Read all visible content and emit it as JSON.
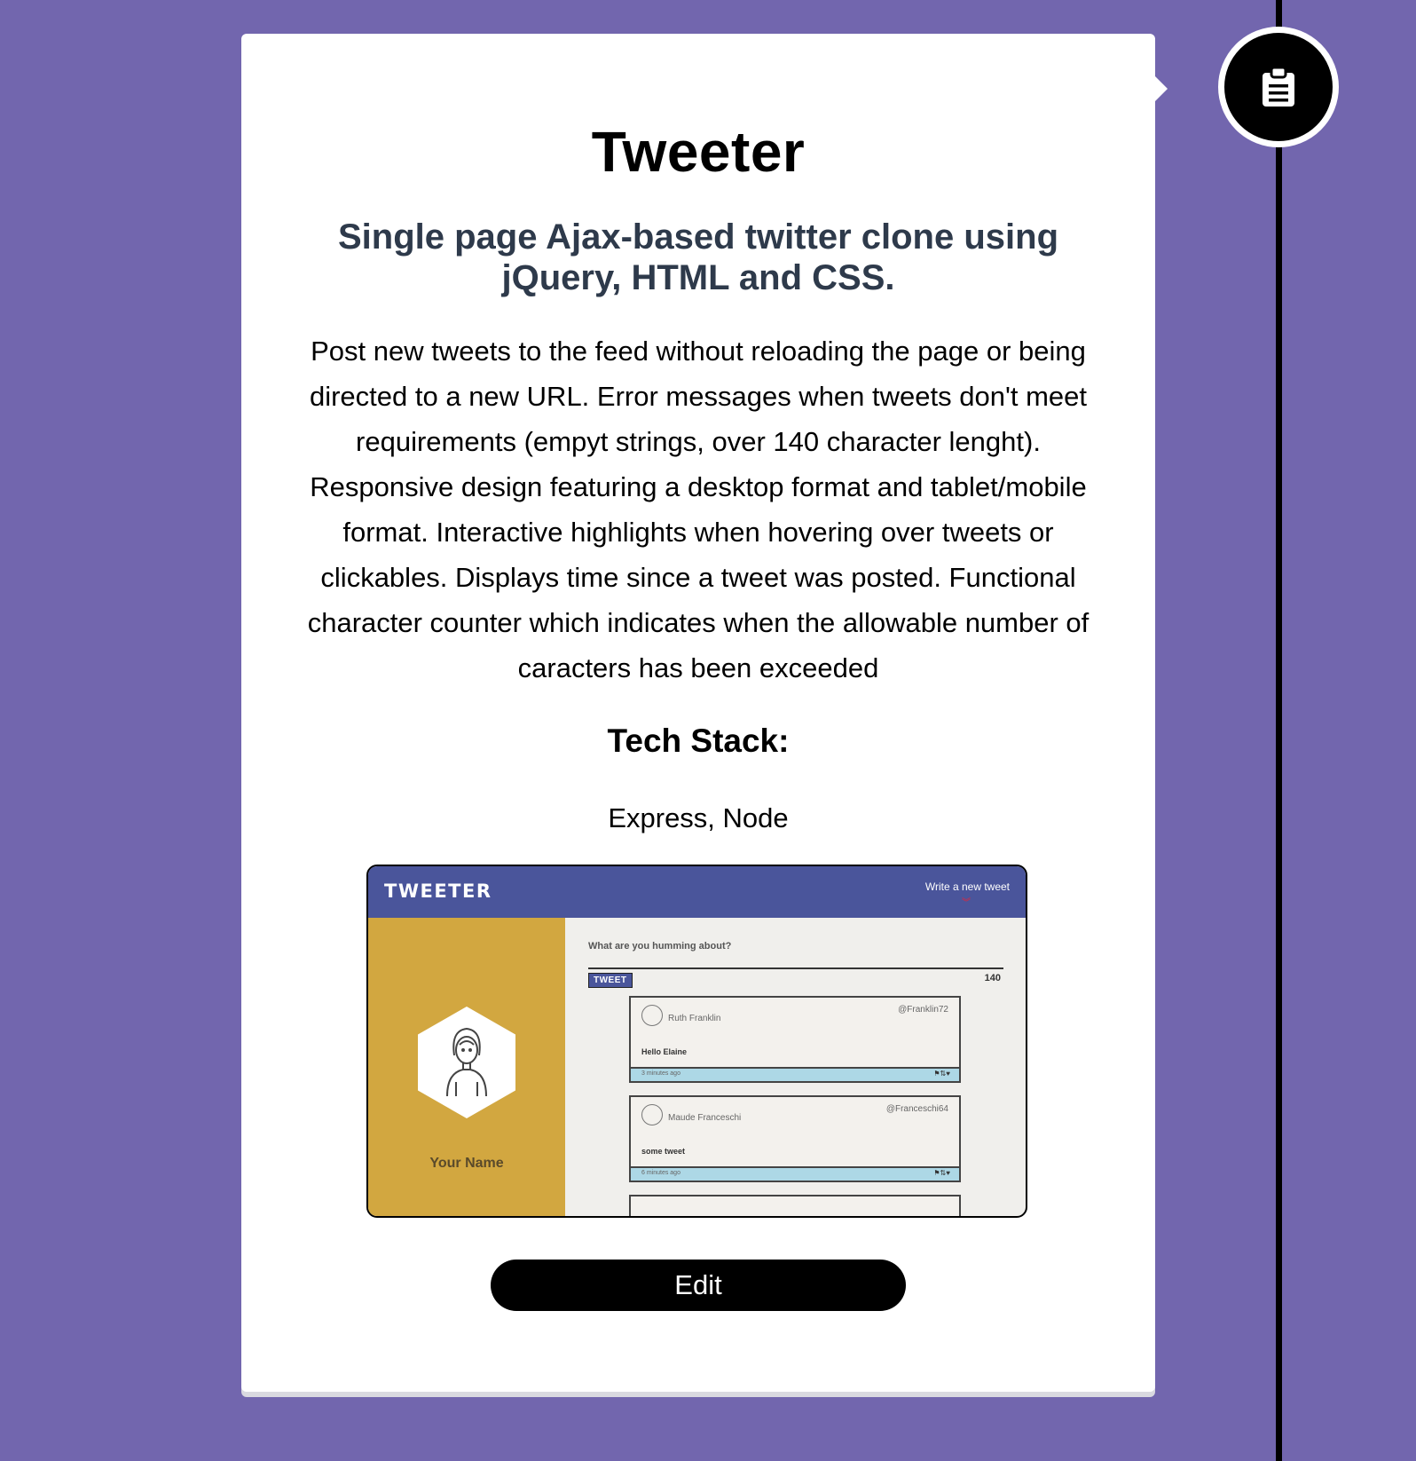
{
  "timeline": {
    "icon": "clipboard-icon"
  },
  "project": {
    "title": "Tweeter",
    "subtitle": "Single page Ajax-based twitter clone using jQuery, HTML and CSS.",
    "description": "Post new tweets to the feed without reloading the page or being directed to a new URL. Error messages when tweets don't meet requirements (empyt strings, over 140 character lenght). Responsive design featuring a desktop format and tablet/mobile format. Interactive highlights when hovering over tweets or clickables. Displays time since a tweet was posted. Functional character counter which indicates when the allowable number of caracters has been exceeded",
    "tech_stack_heading": "Tech Stack:",
    "tech_stack": "Express, Node",
    "edit_label": "Edit"
  },
  "screenshot": {
    "brand": "TWEETER",
    "compose_link": "Write a new tweet",
    "profile_name": "Your Name",
    "compose_prompt": "What are you humming about?",
    "tweet_button": "TWEET",
    "counter": "140",
    "tweets": [
      {
        "name": "Ruth Franklin",
        "handle": "@Franklin72",
        "body": "Hello Elaine",
        "time": "3 minutes ago"
      },
      {
        "name": "Maude Franceschi",
        "handle": "@Franceschi64",
        "body": "some tweet",
        "time": "6 minutes ago"
      }
    ]
  },
  "colors": {
    "background": "#7266ae",
    "card": "#ffffff",
    "subtitle": "#2e3a4b",
    "nav": "#4a559b",
    "sidebar": "#d2a740",
    "tweet_footer": "#add8e6"
  }
}
